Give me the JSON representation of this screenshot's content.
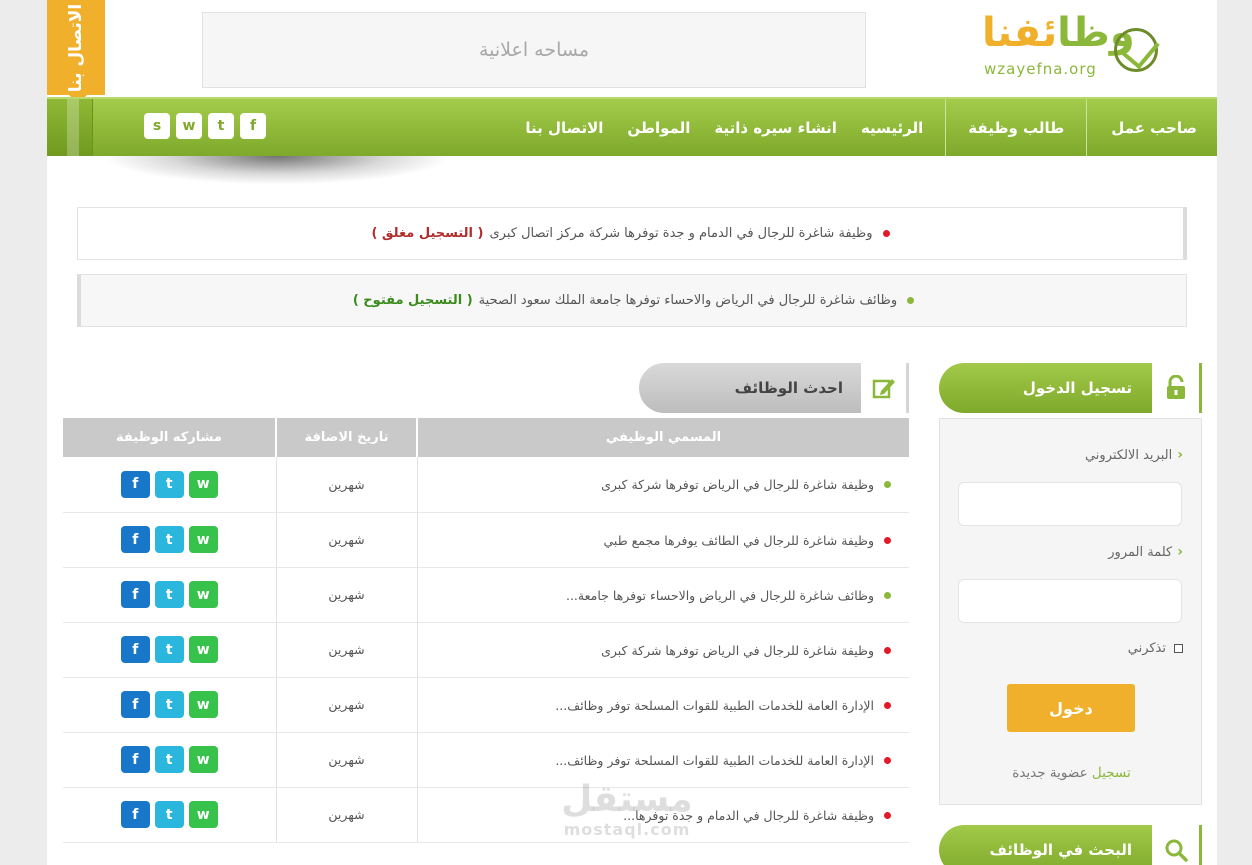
{
  "header": {
    "contact_tab": "الاتصال بنا",
    "ad_text": "مساحه اعلانية",
    "logo_main": "وظا",
    "logo_accent": "ئفنا",
    "logo_url": "wzayefna.org"
  },
  "nav": {
    "items": [
      "صاحب عمل",
      "طالب وظيفة",
      "الرئيسيه",
      "انشاء سيره ذاتية",
      "المواطن",
      "الاتصال بنا"
    ],
    "social": [
      {
        "icon": "facebook-icon",
        "glyph": "f"
      },
      {
        "icon": "twitter-icon",
        "glyph": "t"
      },
      {
        "icon": "whatsapp-icon",
        "glyph": "w"
      },
      {
        "icon": "snapchat-icon",
        "glyph": "s"
      }
    ]
  },
  "alerts": [
    {
      "text": "وظيفة شاغرة للرجال في الدمام و جدة توفرها شركة مركز اتصال كبرى",
      "status": "( التسجيل مغلق )",
      "color": "red"
    },
    {
      "text": "وظائف شاغرة للرجال في الرياض والاحساء توفرها جامعة الملك سعود الصحية",
      "status": "( التسجيل مفتوح )",
      "color": "green"
    }
  ],
  "latest_jobs": {
    "title": "احدث الوظائف",
    "columns": [
      "المسمي الوظيفي",
      "تاريخ الاضافة",
      "مشاركه الوظيفة"
    ],
    "rows": [
      {
        "title": "وظيفة شاغرة للرجال في الرياض توفرها شركة كبرى",
        "date": "شهرين",
        "dot": "green"
      },
      {
        "title": "وظيفة شاغرة للرجال في الطائف يوفرها مجمع طبي",
        "date": "شهرين",
        "dot": "red"
      },
      {
        "title": "وظائف شاغرة للرجال في الرياض والاحساء توفرها جامعة...",
        "date": "شهرين",
        "dot": "green"
      },
      {
        "title": "وظيفة شاغرة للرجال في الرياض توفرها شركة كبرى",
        "date": "شهرين",
        "dot": "red"
      },
      {
        "title": "الإدارة العامة للخدمات الطبية للقوات المسلحة توفر وظائف...",
        "date": "شهرين",
        "dot": "red"
      },
      {
        "title": "الإدارة العامة للخدمات الطبية للقوات المسلحة توفر وظائف...",
        "date": "شهرين",
        "dot": "red"
      },
      {
        "title": "وظيفة شاغرة للرجال في الدمام و جدة توفرها...",
        "date": "شهرين",
        "dot": "red"
      }
    ]
  },
  "login": {
    "title": "تسجيل الدخول",
    "email_label": "البريد الالكتروني",
    "password_label": "كلمة المرور",
    "remember_label": "تذكرني",
    "submit_label": "دخول",
    "register_link": "تسجيل",
    "register_text": "عضوية جديدة"
  },
  "search": {
    "title": "البحث في الوظائف"
  },
  "watermark": {
    "arabic": "مستقل",
    "latin": "mostaql.com"
  },
  "colors": {
    "brand_green": "#8bb83a",
    "brand_orange": "#f1b02c",
    "closed_red": "#b12c2c",
    "open_green": "#3a8a1c"
  }
}
